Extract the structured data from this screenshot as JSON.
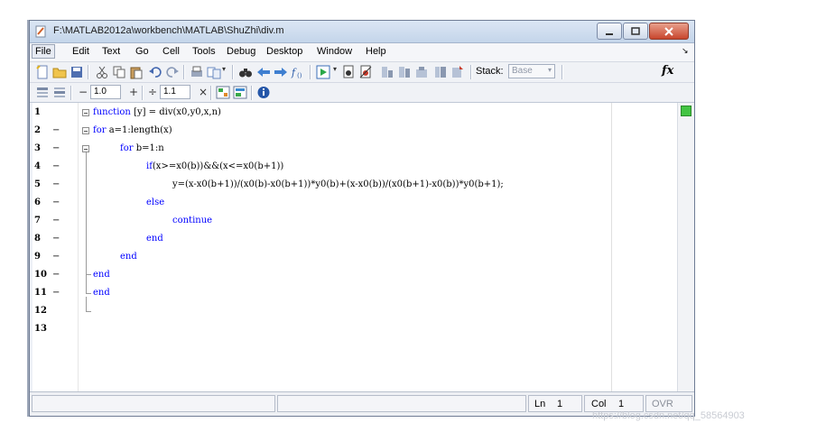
{
  "window": {
    "title": "F:\\MATLAB2012a\\workbench\\MATLAB\\ShuZhi\\div.m"
  },
  "menubar": {
    "items": [
      "File",
      "Edit",
      "Text",
      "Go",
      "Cell",
      "Tools",
      "Debug",
      "Desktop",
      "Window",
      "Help"
    ],
    "overflow": "↘"
  },
  "toolbar": {
    "icons": [
      "new-file-icon",
      "open-folder-icon",
      "save-icon",
      "cut-icon",
      "copy-icon",
      "paste-icon",
      "undo-icon",
      "redo-icon",
      "print-icon",
      "compare-icon",
      "find-icon",
      "back-icon",
      "forward-icon",
      "function-browser-icon",
      "run-icon",
      "run-dropdown-icon",
      "breakpoint-set-icon",
      "breakpoint-clear-icon",
      "step-icon",
      "step-in-icon",
      "step-out-icon",
      "continue-icon",
      "exit-debug-icon"
    ],
    "stack_label": "Stack:",
    "stack_value": "Base",
    "fx_label": "fx"
  },
  "cell_toolbar": {
    "minus": "−",
    "value1": "1.0",
    "plus": "+",
    "divide": "÷",
    "value2": "1.1",
    "times": "×"
  },
  "editor": {
    "line_numbers": [
      "1",
      "2",
      "3",
      "4",
      "5",
      "6",
      "7",
      "8",
      "9",
      "10",
      "11",
      "12",
      "13"
    ],
    "lines": [
      {
        "kw": "function",
        "text": " [y] = div(x0,y0,x,n)"
      },
      {
        "kw": "for",
        "text": " a=1:length(x)"
      },
      {
        "kw": "for",
        "text": " b=1:n"
      },
      {
        "kw": "if",
        "text": "(x>=x0(b))&&(x<=x0(b+1))"
      },
      {
        "kw": "",
        "text": "y=(x-x0(b+1))/(x0(b)-x0(b+1))*y0(b)+(x-x0(b))/(x0(b+1)-x0(b))*y0(b+1);"
      },
      {
        "kw": "else",
        "text": ""
      },
      {
        "kw": "continue",
        "text": ""
      },
      {
        "kw": "end",
        "text": ""
      },
      {
        "kw": "end",
        "text": ""
      },
      {
        "kw": "end",
        "text": ""
      },
      {
        "kw": "end",
        "text": ""
      },
      {
        "kw": "",
        "text": ""
      },
      {
        "kw": "",
        "text": ""
      }
    ],
    "dash": "−"
  },
  "statusbar": {
    "ln_label": "Ln",
    "ln_value": "1",
    "col_label": "Col",
    "col_value": "1",
    "ovr": "OVR"
  },
  "watermark": "https://blog.csdn.net/qq_58564903",
  "colors": {
    "keyword": "#0000ff",
    "title_bg": "#c4d5ea",
    "close_button": "#c8462d"
  }
}
